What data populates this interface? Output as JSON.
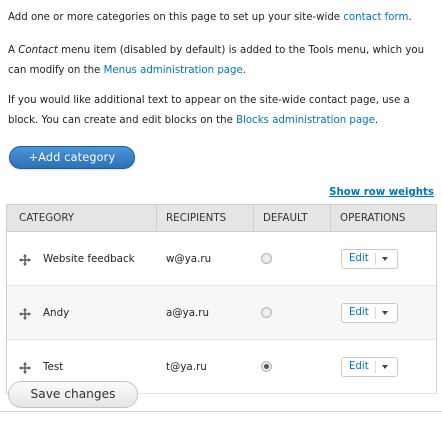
{
  "intro": {
    "p1_text": "Add one or more categories on this page to set up your site-wide ",
    "p1_link": "contact form",
    "p1_end": ".",
    "p2_a": "A ",
    "p2_em": "Contact",
    "p2_b": " menu item (disabled by default) is added to the Tools menu, which you can modify on the ",
    "p2_link": "Menus administration page",
    "p2_end": ".",
    "p3_text": "If you would like additional text to appear on the site-wide contact page, use a block. You can create and edit blocks on the ",
    "p3_link": "Blocks administration page",
    "p3_end": "."
  },
  "toolbar": {
    "add_label": "+Add category",
    "row_weights_label": "Show row weights"
  },
  "table": {
    "headers": [
      "CATEGORY",
      "RECIPIENTS",
      "DEFAULT",
      "OPERATIONS"
    ],
    "rows": [
      {
        "category": "Website feedback",
        "recipients": "w@ya.ru",
        "default": false,
        "edit": "Edit"
      },
      {
        "category": "Andy",
        "recipients": "a@ya.ru",
        "default": false,
        "edit": "Edit"
      },
      {
        "category": "Test",
        "recipients": "t@ya.ru",
        "default": true,
        "edit": "Edit"
      }
    ]
  },
  "actions": {
    "save_label": "Save changes"
  },
  "colors": {
    "link": "#0074bd",
    "primary_button": "#3a80c6",
    "header_bg": "#e5e5e3"
  }
}
